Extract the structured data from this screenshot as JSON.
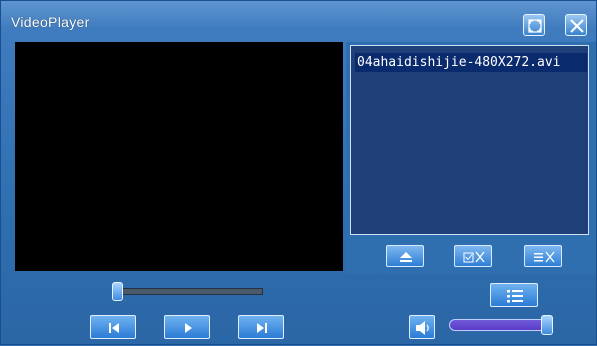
{
  "window": {
    "title": "VideoPlayer"
  },
  "playlist": {
    "items": [
      {
        "label": "04ahaidishijie-480X272.avi",
        "selected": true
      }
    ]
  },
  "controls": {
    "seek_progress": 0.0,
    "volume_level": 1.0
  },
  "icons": {
    "fullscreen": "fullscreen-icon",
    "close": "close-icon",
    "eject": "eject-icon",
    "remove_checked": "remove-checked-icon",
    "clear_list": "clear-list-icon",
    "playlist_toggle": "playlist-toggle-icon",
    "previous": "previous-icon",
    "play": "play-icon",
    "next": "next-icon",
    "volume": "speaker-icon"
  },
  "colors": {
    "window_blue": "#2f6fb0",
    "video_bg": "#000000",
    "playlist_bg": "#1f3f78",
    "selected_item": "#0a2a6e",
    "volume_fill": "#6f59d8"
  }
}
